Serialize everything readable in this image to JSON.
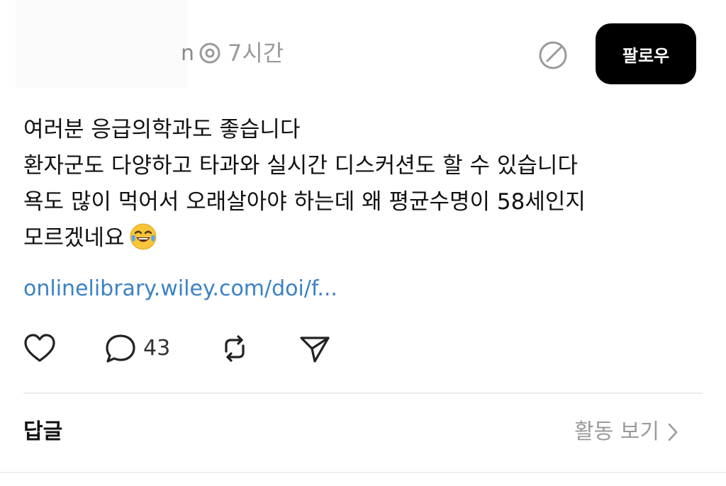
{
  "header": {
    "username_tail": "n",
    "timestamp": "7시간",
    "follow_label": "팔로우"
  },
  "post": {
    "lines": [
      "여러분 응급의학과도 좋습니다",
      "환자군도 다양하고 타과와 실시간 디스커션도 할 수 있습니다",
      "욕도 많이 먹어서 오래살아야 하는데 왜 평균수명이 58세인지",
      "모르겠네요"
    ],
    "emoji": "face-with-tears-of-joy",
    "link_text": "onlinelibrary.wiley.com/doi/f..."
  },
  "actions": {
    "comment_count": "43"
  },
  "replies": {
    "label": "답글",
    "activity_label": "활동 보기"
  },
  "colors": {
    "link": "#3b82c4",
    "follow_bg": "#000000",
    "muted_text": "#9a9a9a"
  }
}
